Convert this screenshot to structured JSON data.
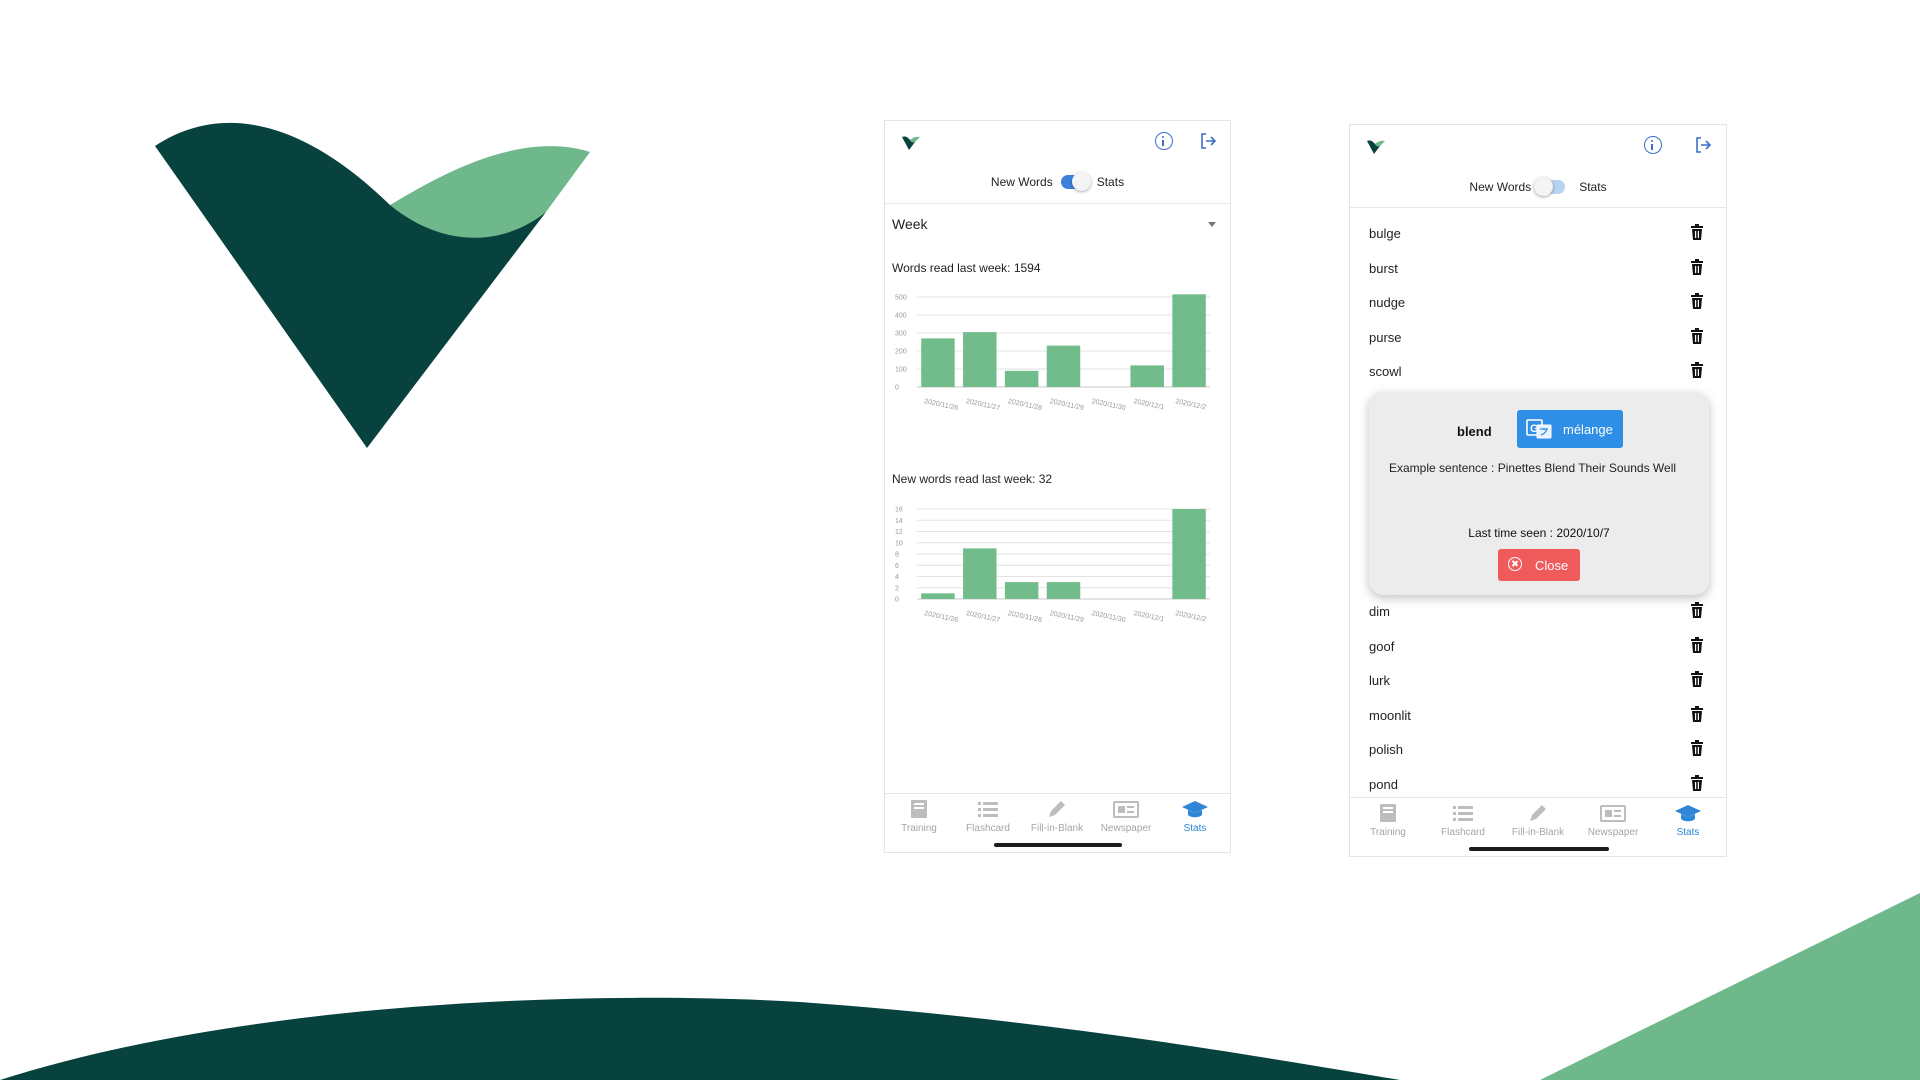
{
  "brand": {
    "dark_green": "#08423f",
    "light_green": "#6eb88c",
    "accent_blue": "#2f86d6",
    "toggle_blue": "#3c82dc",
    "close_red": "#ef5b5b"
  },
  "stats_screen": {
    "header_icons": [
      "logo-icon",
      "info-icon",
      "logout-icon"
    ],
    "mode_toggle": {
      "left_label": "New Words",
      "right_label": "Stats",
      "active": "Stats"
    },
    "period_select": {
      "value": "Week"
    },
    "charts": {
      "words_read": {
        "title": "Words read last week: 1594"
      },
      "new_words": {
        "title": "New words read last week: 32"
      }
    },
    "tabs": [
      {
        "label": "Training",
        "icon": "book-icon",
        "active": false
      },
      {
        "label": "Flashcard",
        "icon": "list-icon",
        "active": false
      },
      {
        "label": "Fill-in-Blank",
        "icon": "pencil-icon",
        "active": false
      },
      {
        "label": "Newspaper",
        "icon": "newspaper-icon",
        "active": false
      },
      {
        "label": "Stats",
        "icon": "graduation-cap-icon",
        "active": true
      }
    ]
  },
  "chart_data": [
    {
      "type": "bar",
      "title": "Words read last week: 1594",
      "categories": [
        "2020/11/26",
        "2020/11/27",
        "2020/11/28",
        "2020/11/29",
        "2020/11/30",
        "2020/12/1",
        "2020/12/2"
      ],
      "values": [
        270,
        305,
        90,
        230,
        0,
        120,
        540
      ],
      "ylim": [
        0,
        500
      ],
      "yticks": [
        0,
        100,
        200,
        300,
        400,
        500
      ],
      "grid": true
    },
    {
      "type": "bar",
      "title": "New words read last week: 32",
      "categories": [
        "2020/11/26",
        "2020/11/27",
        "2020/11/28",
        "2020/11/29",
        "2020/11/30",
        "2020/12/1",
        "2020/12/2"
      ],
      "values": [
        1,
        9,
        3,
        3,
        0,
        0,
        16
      ],
      "ylim": [
        0,
        16
      ],
      "yticks": [
        0,
        2,
        4,
        6,
        8,
        10,
        12,
        14,
        16
      ],
      "grid": true
    }
  ],
  "words_screen": {
    "mode_toggle": {
      "left_label": "New Words",
      "right_label": "Stats",
      "active": "New Words"
    },
    "words_top": [
      "bulge",
      "burst",
      "nudge",
      "purse",
      "scowl"
    ],
    "words_bottom": [
      "dim",
      "goof",
      "lurk",
      "moonlit",
      "polish",
      "pond"
    ],
    "popup": {
      "word": "blend",
      "translation": "mélange",
      "example": "Example sentence : Pinettes Blend Their Sounds Well",
      "last_seen": "Last time seen : 2020/10/7",
      "close_label": "Close"
    },
    "tabs": [
      {
        "label": "Training",
        "icon": "book-icon",
        "active": false
      },
      {
        "label": "Flashcard",
        "icon": "list-icon",
        "active": false
      },
      {
        "label": "Fill-in-Blank",
        "icon": "pencil-icon",
        "active": false
      },
      {
        "label": "Newspaper",
        "icon": "newspaper-icon",
        "active": false
      },
      {
        "label": "Stats",
        "icon": "graduation-cap-icon",
        "active": true
      }
    ]
  }
}
